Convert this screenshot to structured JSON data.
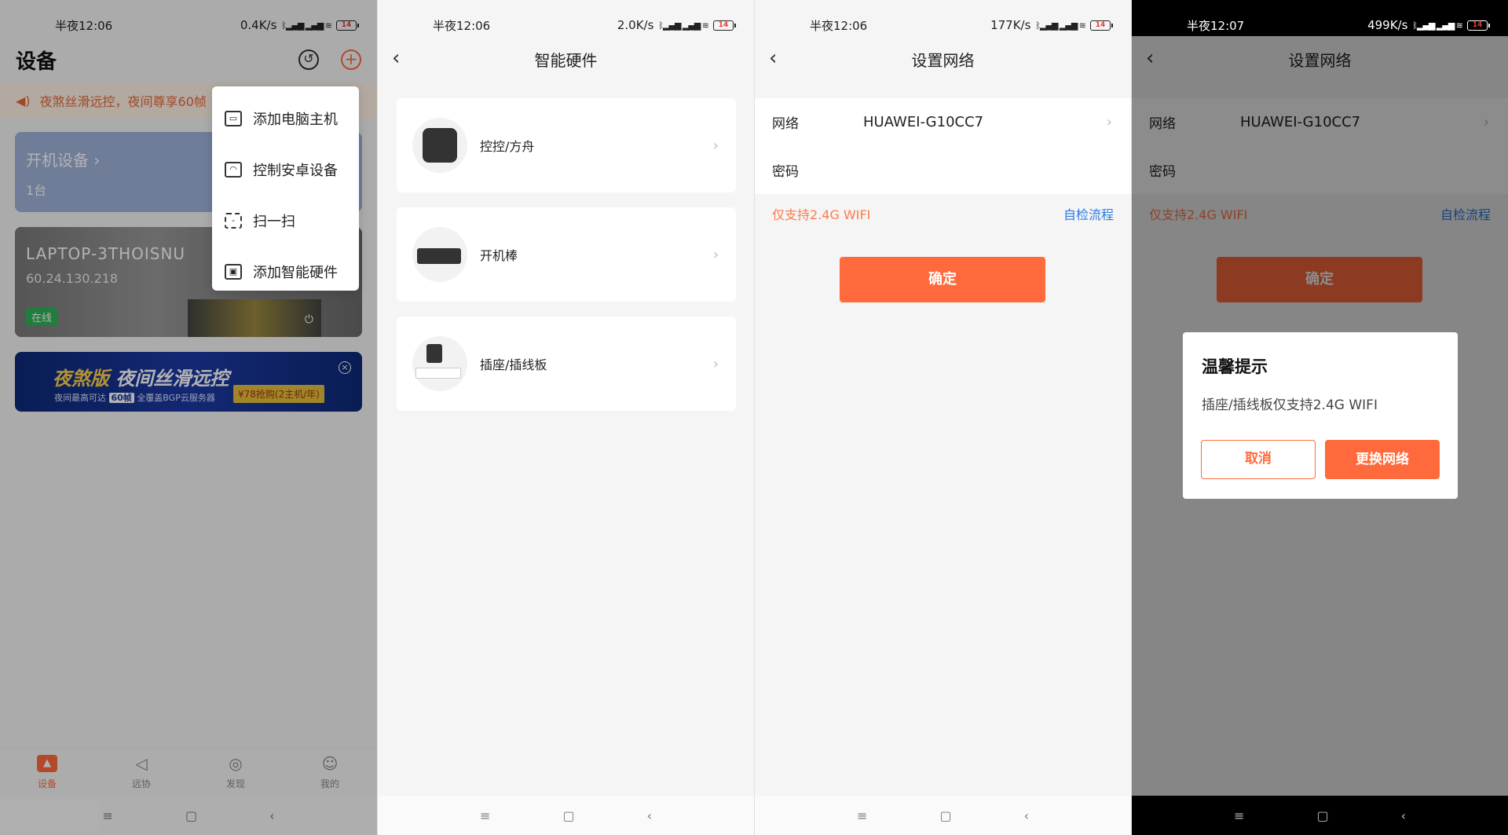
{
  "screen1": {
    "status": {
      "time": "半夜12:06",
      "speed": "0.4K/s",
      "battery": "14"
    },
    "title": "设备",
    "notice": "夜煞丝滑远控，夜间尊享60帧",
    "open_device": {
      "title": "开机设备",
      "count": "1台"
    },
    "laptop": {
      "name": "LAPTOP-3THOISNU",
      "ip": "60.24.130.218",
      "status": "在线"
    },
    "ad": {
      "brand": "夜煞版",
      "slogan": "夜间丝滑远控",
      "line1": "夜间最高可达",
      "fps": "60帧",
      "line2": "全覆盖BGP云服务器",
      "price": "¥78抢购(2主机/年)"
    },
    "menu": [
      "添加电脑主机",
      "控制安卓设备",
      "扫一扫",
      "添加智能硬件"
    ],
    "tabs": [
      "设备",
      "远协",
      "发现",
      "我的"
    ]
  },
  "screen2": {
    "status": {
      "time": "半夜12:06",
      "speed": "2.0K/s",
      "battery": "14"
    },
    "title": "智能硬件",
    "items": [
      "控控/方舟",
      "开机棒",
      "插座/插线板"
    ]
  },
  "screen3": {
    "status": {
      "time": "半夜12:06",
      "speed": "177K/s",
      "battery": "14"
    },
    "title": "设置网络",
    "network_label": "网络",
    "network_value": "HUAWEI-G10CC7",
    "password_label": "密码",
    "hint": "仅支持2.4G WIFI",
    "link": "自检流程",
    "confirm": "确定"
  },
  "screen4": {
    "status": {
      "time": "半夜12:07",
      "speed": "499K/s",
      "battery": "14"
    },
    "title": "设置网络",
    "network_label": "网络",
    "network_value": "HUAWEI-G10CC7",
    "password_label": "密码",
    "hint": "仅支持2.4G WIFI",
    "link": "自检流程",
    "confirm": "确定",
    "dialog": {
      "title": "温馨提示",
      "message": "插座/插线板仅支持2.4G WIFI",
      "cancel": "取消",
      "ok": "更换网络"
    }
  },
  "colors": {
    "accent": "#ff6a3c",
    "link": "#2a7ae2",
    "online": "#2fb35a"
  }
}
